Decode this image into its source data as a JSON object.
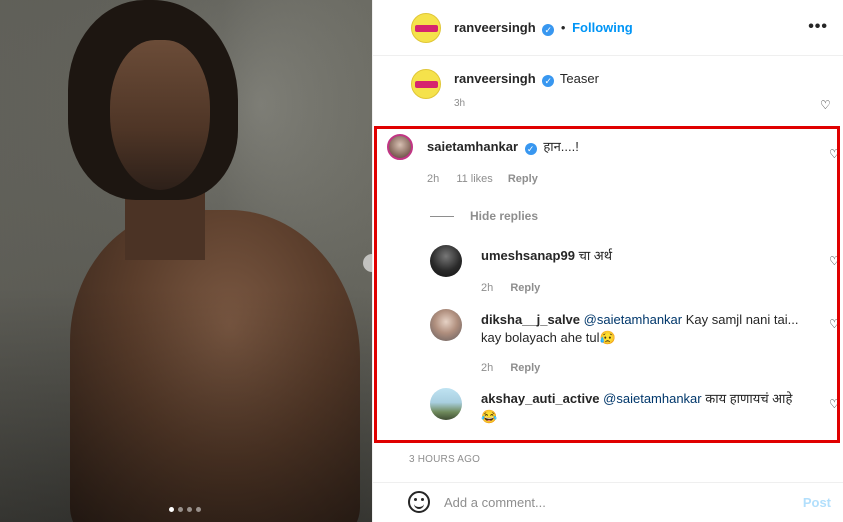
{
  "photo": {
    "carousel_dots": 4,
    "active_dot": 1
  },
  "header": {
    "username": "ranveersingh",
    "separator": "•",
    "follow_status": "Following",
    "more": "•••"
  },
  "caption": {
    "username": "ranveersingh",
    "text": "Teaser",
    "time": "3h"
  },
  "comments": [
    {
      "username": "saietamhankar",
      "verified": true,
      "text": "हान....!",
      "time": "2h",
      "likes": "11 likes",
      "reply": "Reply"
    }
  ],
  "hide_replies": "Hide replies",
  "replies": [
    {
      "username": "umeshsanap99",
      "text": "चा अर्थ",
      "time": "2h",
      "reply": "Reply"
    },
    {
      "username": "diksha__j_salve",
      "mention": "@saietamhankar",
      "text": " Kay samjl nani tai...",
      "text2": "kay bolayach ahe tul😥",
      "time": "2h",
      "reply": "Reply"
    },
    {
      "username": "akshay_auti_active",
      "mention": "@saietamhankar",
      "text": " काय हाणायचं आहे",
      "text2": "😂"
    }
  ],
  "time_ago": "3 HOURS AGO",
  "footer": {
    "placeholder": "Add a comment...",
    "post": "Post"
  },
  "colors": {
    "highlight": "#e00000",
    "link": "#0095f6",
    "verified": "#3897f0"
  }
}
